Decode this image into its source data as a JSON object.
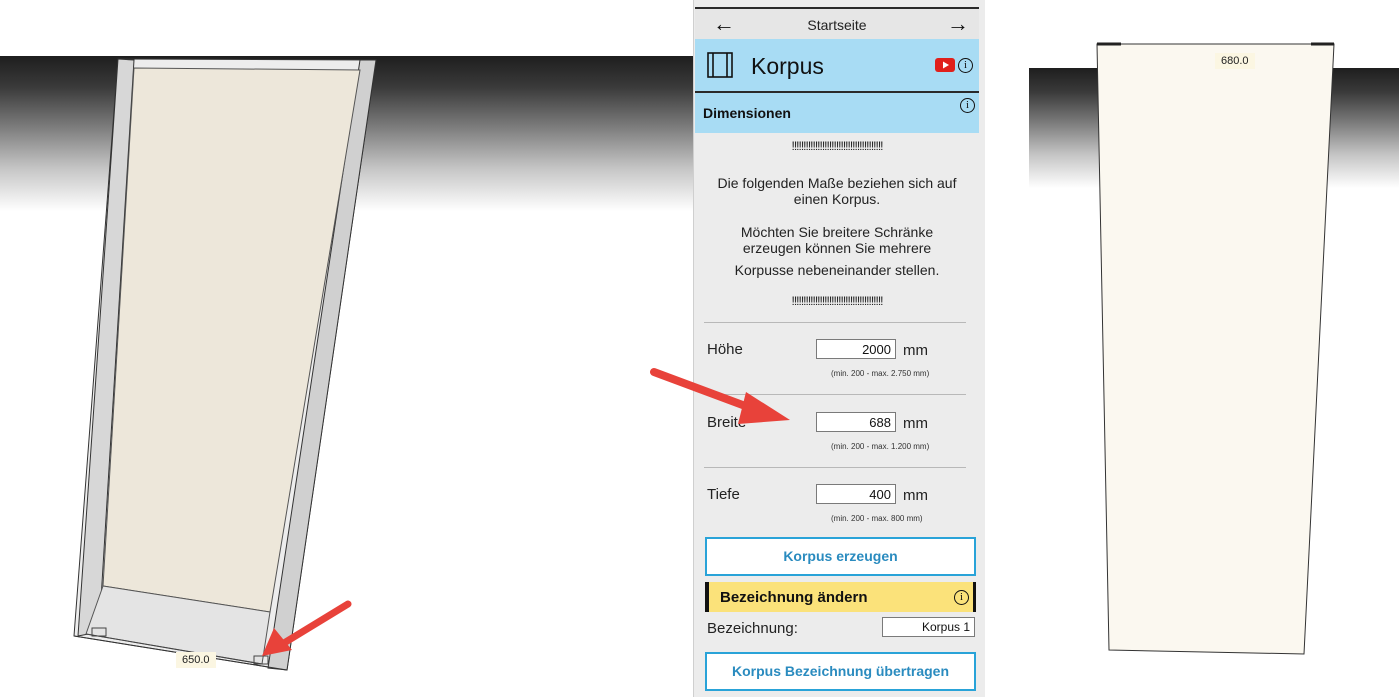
{
  "nav": {
    "title": "Startseite",
    "back_icon": "arrow-left-icon",
    "forward_icon": "arrow-right-icon"
  },
  "header": {
    "title": "Korpus",
    "icon": "cabinet-icon",
    "video_icon": "youtube-icon",
    "info_icon": "info-icon"
  },
  "section": {
    "title": "Dimensionen",
    "info_icon": "info-icon"
  },
  "notes": {
    "excl_top": "!!!!!!!!!!!!!!!!!!!!!!!!!!!!!!!!!!!!!!!",
    "line1": "Die folgenden Maße beziehen sich auf",
    "line2": "einen Korpus.",
    "line3": "Möchten Sie breitere Schränke",
    "line4": "erzeugen können Sie mehrere",
    "line5": "Korpusse nebeneinander stellen.",
    "excl_bottom": "!!!!!!!!!!!!!!!!!!!!!!!!!!!!!!!!!!!!!!!"
  },
  "fields": [
    {
      "label": "Höhe",
      "value": "2000",
      "unit": "mm",
      "hint": "(min. 200 - max. 2.750 mm)"
    },
    {
      "label": "Breite",
      "value": "688",
      "unit": "mm",
      "hint": "(min. 200 - max. 1.200 mm)"
    },
    {
      "label": "Tiefe",
      "value": "400",
      "unit": "mm",
      "hint": "(min. 200 - max. 800 mm)"
    }
  ],
  "create_button": "Korpus erzeugen",
  "rename": {
    "title": "Bezeichnung ändern",
    "label": "Bezeichnung:",
    "value": "Korpus 1",
    "info_icon": "info-icon",
    "transfer_button": "Korpus Bezeichnung übertragen"
  },
  "viewport_left": {
    "dimension": "650.0"
  },
  "viewport_right": {
    "dimension": "680.0"
  },
  "colors": {
    "header_blue": "#a8dcf4",
    "yellow": "#fbe27a",
    "button_blue": "#29a3d8",
    "arrow_red": "#e8423a"
  }
}
